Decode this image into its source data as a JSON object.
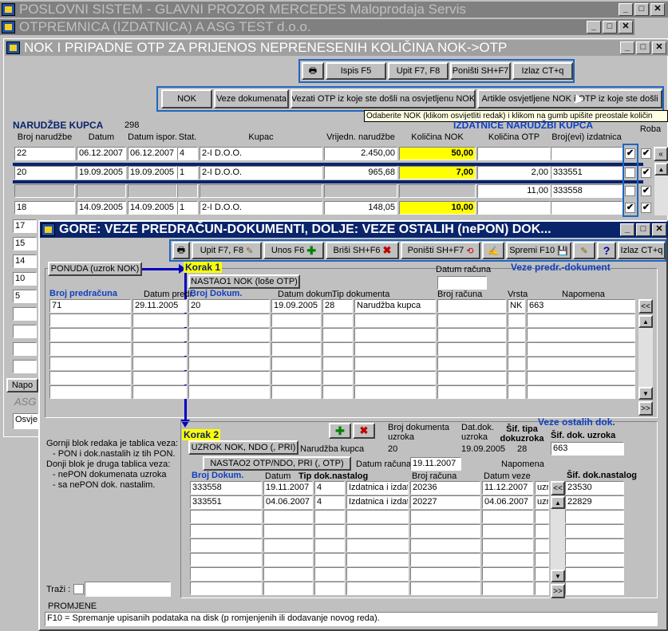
{
  "windows": {
    "main_title": "POSLOVNI SISTEM - GLAVNI PROZOR  MERCEDES  Maloprodaja  Servis",
    "otpremnica_title": "OTPREMNICA (IZDATNICA)        A ASG TEST d.o.o.",
    "nok_title": "NOK I PRIPADNE OTP ZA PRIJENOS NEPRENESENIH KOLIČINA NOK->OTP",
    "veze_title": "GORE: VEZE PREDRAČUN-DOKUMENTI,  DOLJE:  VEZE OSTALIH (nePON) DOK...",
    "min": "_",
    "max": "□",
    "close": "✕"
  },
  "nok_toolbar": {
    "ispis": "Ispis F5",
    "upit": "Upit F7, F8",
    "ponisti": "Poništi SH+F7",
    "izlaz": "Izlaz CT+q"
  },
  "nok_buttons": {
    "nok": "NOK",
    "veze": "Veze dokumenata",
    "vezati": "Vezati OTP iz koje ste došli na osvjetljenu NOK",
    "artikle": "Artikle osvjetljene NOK i OTP iz koje ste došli"
  },
  "tooltip": "Odaberite NOK (klikom osvijetliti redak) i klikom na gumb upišite  preostale količin",
  "narudzbe": {
    "title": "NARUDŽBE KUPCA",
    "count": "298",
    "izdatnice_title": "IZDATNICE NARUDŽBI KUPCA",
    "headers": [
      "Broj narudžbe",
      "Datum",
      "Datum ispor.",
      "Stat.",
      "Kupac",
      "Vrijedn. narudžbe",
      "Količina NOK",
      "Količina OTP",
      "Broj(evi) izdatnica",
      "Roba"
    ],
    "rows": [
      {
        "broj": "22",
        "datum": "06.12.2007",
        "ispor": "06.12.2007",
        "stat": "4",
        "kupac": "2-I D.O.O.",
        "vrijednost": "2.450,00",
        "nok": "50,00",
        "otp": "",
        "izdatnica": ""
      },
      {
        "broj": "20",
        "datum": "19.09.2005",
        "ispor": "19.09.2005",
        "stat": "1",
        "kupac": "2-I D.O.O.",
        "vrijednost": "965,68",
        "nok": "7,00",
        "otp": "2,00",
        "izdatnica": "333551"
      },
      {
        "broj": "",
        "datum": "",
        "ispor": "",
        "stat": "",
        "kupac": "",
        "vrijednost": "",
        "nok": "",
        "otp": "11,00",
        "izdatnica": "333558"
      },
      {
        "broj": "18",
        "datum": "14.09.2005",
        "ispor": "14.09.2005",
        "stat": "1",
        "kupac": "2-I D.O.O.",
        "vrijednost": "148,05",
        "nok": "10,00",
        "otp": "",
        "izdatnica": ""
      }
    ],
    "more_rows": [
      "17",
      "15",
      "14",
      "10",
      "5"
    ],
    "napo": "Napo",
    "asg": "ASG",
    "osvje": "Osvje"
  },
  "veze_toolbar": {
    "upit": "Upit F7, F8",
    "unos": "Unos F6",
    "brisi": "Briši  SH+F6",
    "ponisti": "Poništi SH+F7",
    "spremi": "Spremi F10",
    "help": "?",
    "izlaz": "Izlaz CT+q"
  },
  "veze_top": {
    "ponuda": "PONUDA  (uzrok NOK)",
    "korak1": "Korak 1",
    "nastao1": "NASTAO1 NOK  (loše OTP)",
    "datum_racuna": "Datum računa",
    "veze_label": "Veze predr.-dokument",
    "headers": {
      "broj_pred": "Broj predračuna",
      "datum_pred": "Datum predr.",
      "broj_dok": "Broj Dokum.",
      "datum_dok": "Datum dokum.",
      "tip": "Tip dokumenta",
      "broj_rac": "Broj računa",
      "vrsta": "Vrsta",
      "napomena": "Napomena"
    },
    "row": {
      "broj_pred": "71",
      "datum_pred": "29.11.2005",
      "broj_dok": "20",
      "datum_dok": "19.09.2005",
      "tip_code": "28",
      "tip": "Narudžba kupca",
      "broj_rac": "",
      "vrsta": "NK",
      "napomena": "663"
    },
    "first": "<<",
    "last": ">>"
  },
  "notes": {
    "l1": "Gornji blok redaka je tablica veza:",
    "l2": "- PON i dok.nastalih iz tih PON.",
    "l3": "Donji blok je druga tablica veza:",
    "l4": "- nePON dokumenata uzroka",
    "l5": "- sa nePON dok. nastalim.",
    "trazi": "Traži :"
  },
  "veze_bottom": {
    "korak2": "Korak 2",
    "broj_uzroka_lbl": "Broj dokumenta uzroka",
    "dat_uzroka_lbl": "Dat.dok. uzroka",
    "tip_uzroka_lbl": "Šif. tipa dokuzroka",
    "veze_label": "Veze ostalih dok.",
    "sif_uzroka_lbl": "Šif. dok. uzroka",
    "uzrok_btn": "UZROK NOK, NDO (, PRI)",
    "uzrok_tip": "Narudžba kupca",
    "uzrok_broj": "20",
    "uzrok_dat": "19.09.2005",
    "uzrok_tipcode": "28",
    "uzrok_sif": "663",
    "nastao2": "NASTAO2 OTP/NDO, PRI (, OTP)",
    "datum_racuna": "Datum računa",
    "datum_racuna_val": "19.11.2007",
    "napomena": "Napomena",
    "headers": {
      "broj": "Broj Dokum.",
      "datum": "Datum",
      "tip": "Tip dok.nastalog",
      "broj_rac": "Broj računa",
      "datum_veze": "Datum veze",
      "sif": "Šif. dok.nastalog"
    },
    "rows": [
      {
        "broj": "333558",
        "datum": "19.11.2007",
        "tipcode": "4",
        "tip": "Izdatnica i izdat",
        "broj_rac": "20236",
        "datum_veze": "11.12.2007",
        "napom": "uzr",
        "sif": "23530"
      },
      {
        "broj": "333551",
        "datum": "04.06.2007",
        "tipcode": "4",
        "tip": "Izdatnica i izdat",
        "broj_rac": "20227",
        "datum_veze": "04.06.2007",
        "napom": "uzr",
        "sif": "22829"
      }
    ],
    "first": "<<",
    "last": ">>"
  },
  "status": {
    "label": "PROMJENE",
    "text": "F10 = Spremanje upisanih podataka na disk (p romjenjenih ili dodavanje novog reda)."
  }
}
